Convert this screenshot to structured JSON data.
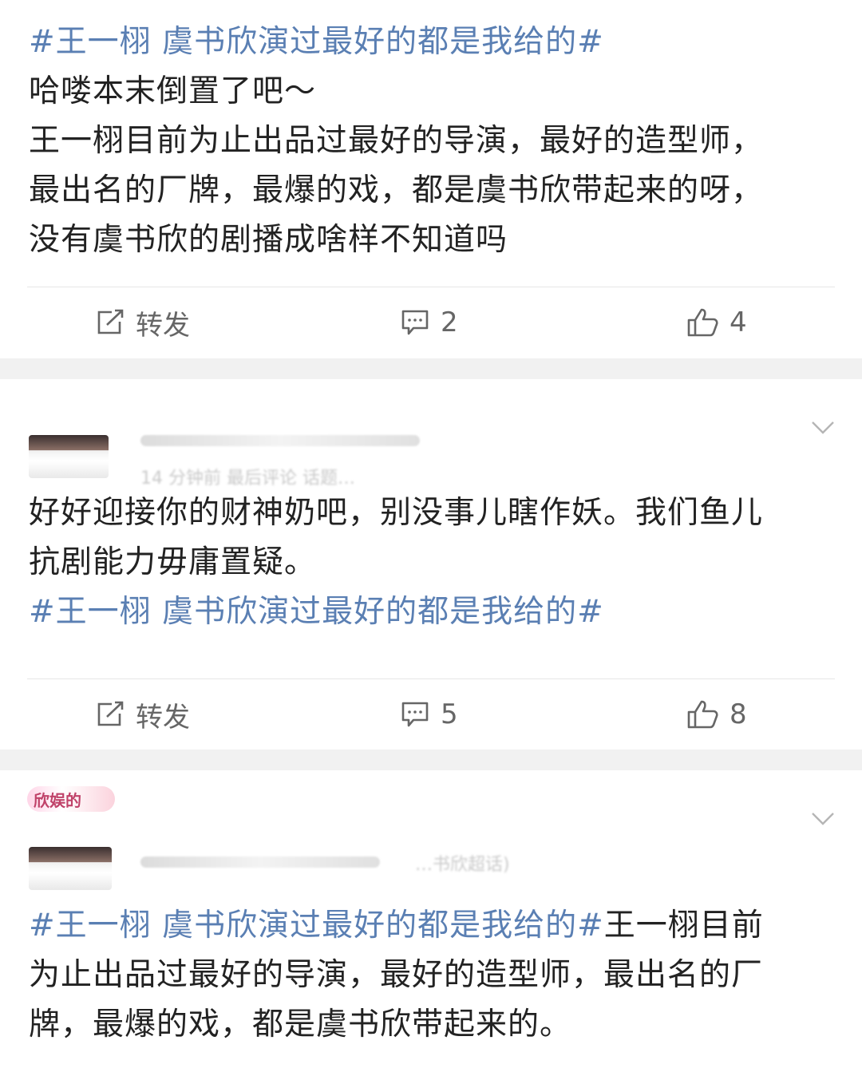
{
  "posts": [
    {
      "hashtag_top": "#王一栩 虞书欣演过最好的都是我给的#",
      "lines": [
        "哈喽本末倒置了吧～",
        "王一栩目前为止出品过最好的导演，最好的造型师，",
        "最出名的厂牌，最爆的戏，都是虞书欣带起来的呀，",
        "没有虞书欣的剧播成啥样不知道吗"
      ],
      "actions": {
        "repost": "转发",
        "comments": "2",
        "likes": "4"
      }
    },
    {
      "meta_blurred": "14 分钟前  最后评论  话题…",
      "lines": [
        "好好迎接你的财神奶吧，别没事儿瞎作妖。我们鱼儿",
        "抗剧能力毋庸置疑。"
      ],
      "hashtag_bottom": "#王一栩 虞书欣演过最好的都是我给的#",
      "actions": {
        "repost": "转发",
        "comments": "5",
        "likes": "8"
      }
    },
    {
      "badge_text": "欣娱的",
      "meta_blurred": "…书欣超话)",
      "line1_hashtag": "#王一栩 虞书欣演过最好的都是我给的#",
      "line1_rest": "王一栩目前",
      "lines": [
        "为止出品过最好的导演，最好的造型师，最出名的厂",
        "牌，最爆的戏，都是虞书欣带起来的。"
      ]
    }
  ],
  "icons": [
    "repost-icon",
    "comment-icon",
    "like-icon",
    "chevron-down-icon"
  ]
}
